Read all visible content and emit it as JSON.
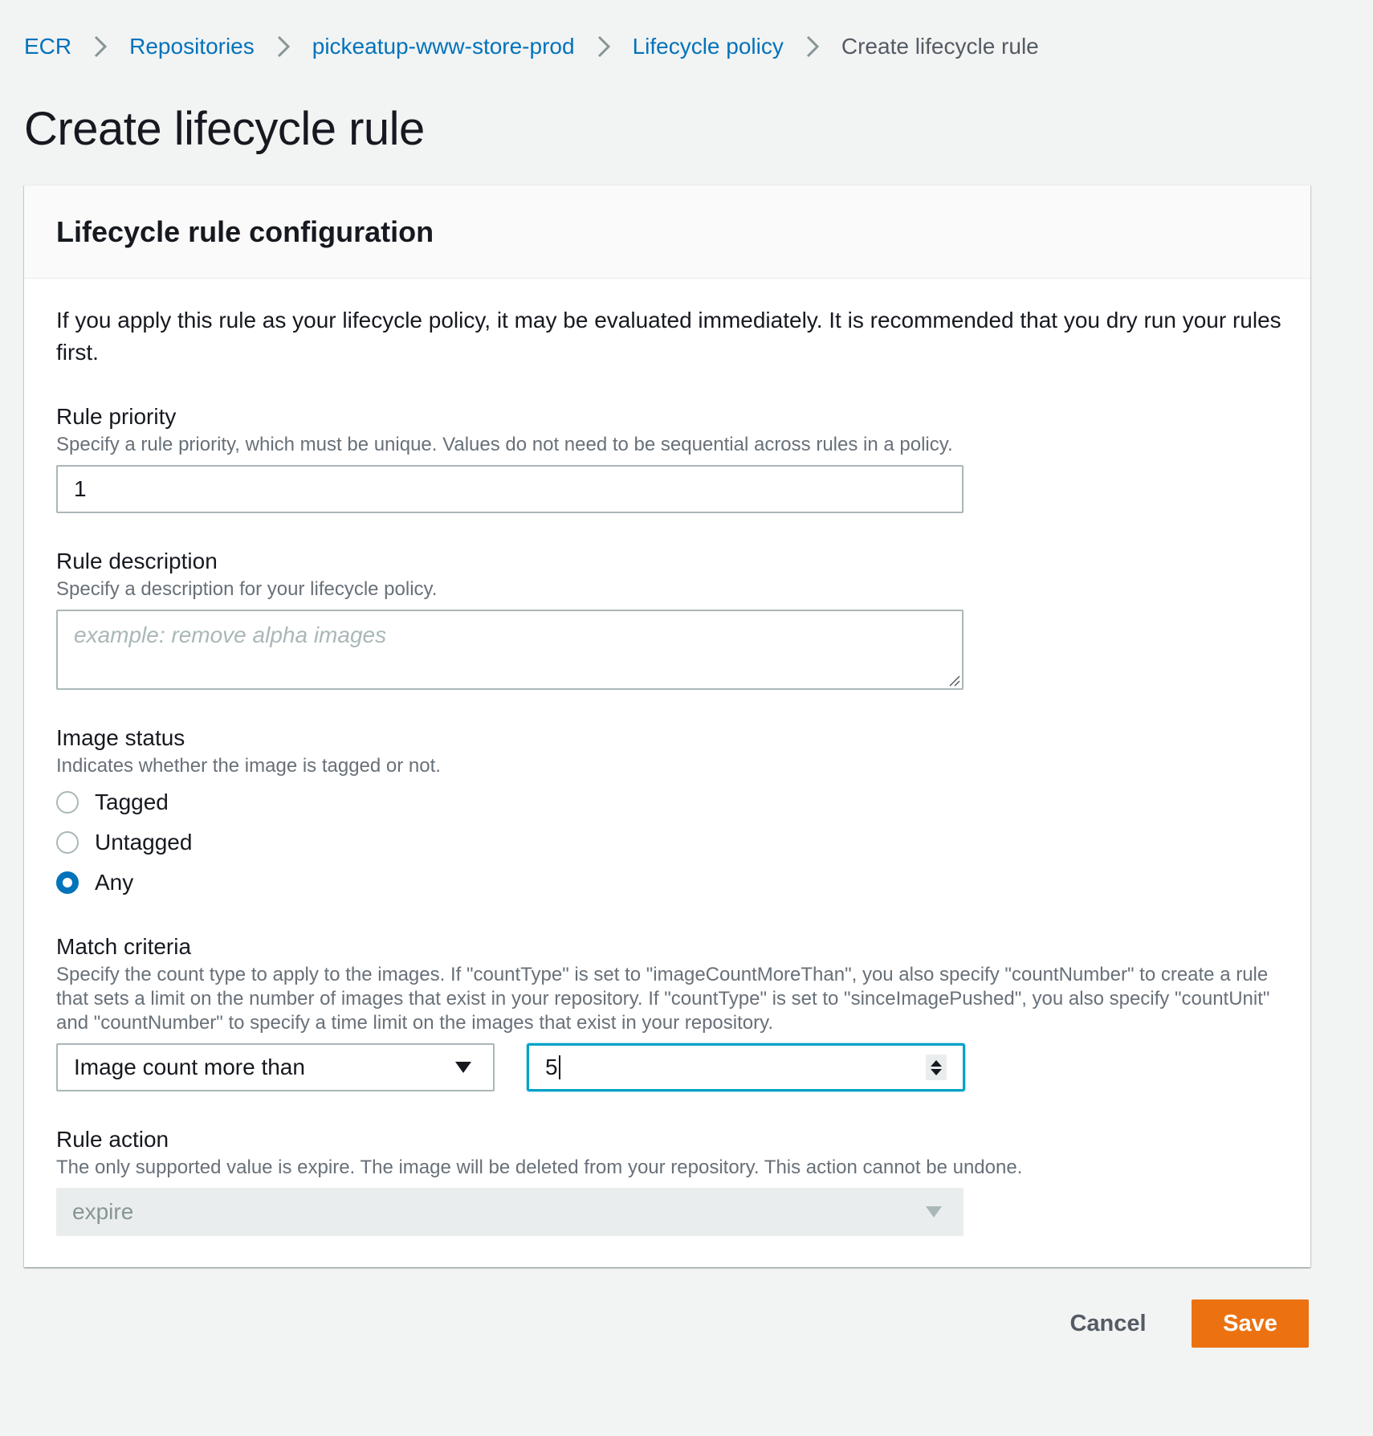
{
  "breadcrumb": {
    "items": [
      {
        "label": "ECR"
      },
      {
        "label": "Repositories"
      },
      {
        "label": "pickeatup-www-store-prod"
      },
      {
        "label": "Lifecycle policy"
      }
    ],
    "current": "Create lifecycle rule"
  },
  "page_title": "Create lifecycle rule",
  "panel": {
    "title": "Lifecycle rule configuration",
    "intro": "If you apply this rule as your lifecycle policy, it may be evaluated immediately. It is recommended that you dry run your rules first."
  },
  "rule_priority": {
    "label": "Rule priority",
    "description": "Specify a rule priority, which must be unique. Values do not need to be sequential across rules in a policy.",
    "value": "1"
  },
  "rule_description": {
    "label": "Rule description",
    "description": "Specify a description for your lifecycle policy.",
    "placeholder": "example: remove alpha images"
  },
  "image_status": {
    "label": "Image status",
    "description": "Indicates whether the image is tagged or not.",
    "options": [
      {
        "label": "Tagged",
        "checked": false
      },
      {
        "label": "Untagged",
        "checked": false
      },
      {
        "label": "Any",
        "checked": true
      }
    ]
  },
  "match_criteria": {
    "label": "Match criteria",
    "description": "Specify the count type to apply to the images. If \"countType\" is set to \"imageCountMoreThan\", you also specify \"countNumber\" to create a rule that sets a limit on the number of images that exist in your repository. If \"countType\" is set to \"sinceImagePushed\", you also specify \"countUnit\" and \"countNumber\" to specify a time limit on the images that exist in your repository.",
    "count_type": "Image count more than",
    "count_number": "5"
  },
  "rule_action": {
    "label": "Rule action",
    "description": "The only supported value is expire. The image will be deleted from your repository. This action cannot be undone.",
    "value": "expire"
  },
  "footer": {
    "cancel_label": "Cancel",
    "save_label": "Save"
  },
  "colors": {
    "link": "#0073bb",
    "primary_button": "#ec7211",
    "focus_border": "#00a1c9",
    "background": "#f2f3f3"
  }
}
